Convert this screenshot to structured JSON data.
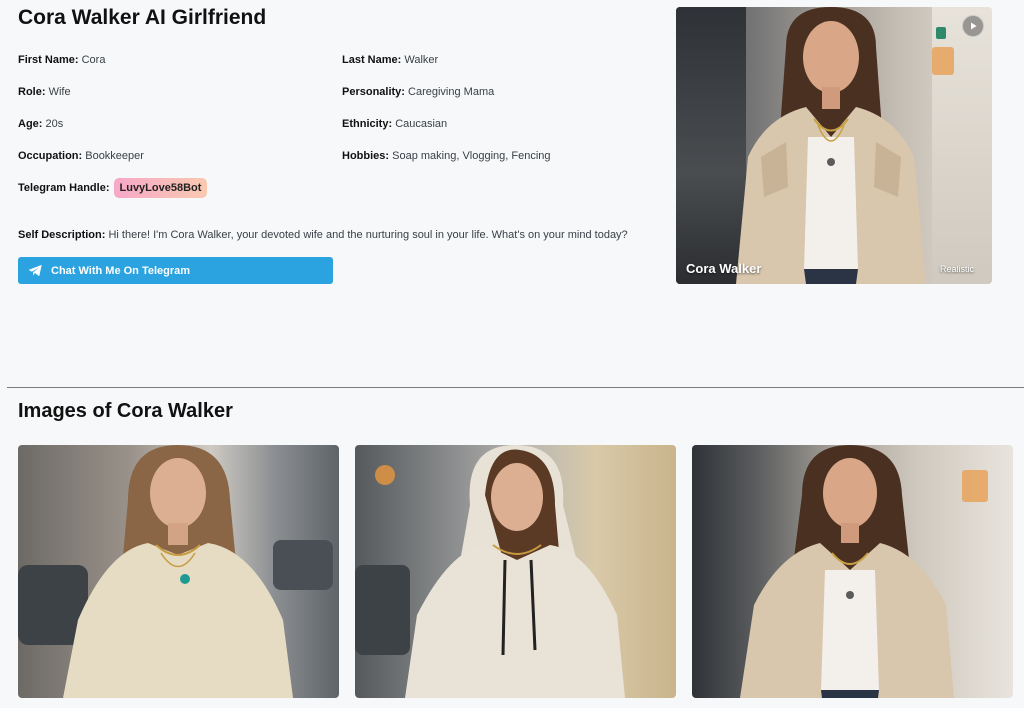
{
  "profile": {
    "title": "Cora Walker AI Girlfriend",
    "fields": {
      "first_name": {
        "label": "First Name:",
        "value": "Cora"
      },
      "last_name": {
        "label": "Last Name:",
        "value": "Walker"
      },
      "role": {
        "label": "Role:",
        "value": "Wife"
      },
      "personality": {
        "label": "Personality:",
        "value": "Caregiving Mama"
      },
      "age": {
        "label": "Age:",
        "value": "20s"
      },
      "ethnicity": {
        "label": "Ethnicity:",
        "value": "Caucasian"
      },
      "occupation": {
        "label": "Occupation:",
        "value": "Bookkeeper"
      },
      "hobbies": {
        "label": "Hobbies:",
        "value": "Soap making, Vlogging, Fencing"
      }
    },
    "telegram": {
      "label": "Telegram Handle:",
      "handle": "LuvyLove58Bot"
    },
    "self_description": {
      "label": "Self Description:",
      "text": "Hi there! I'm Cora Walker, your devoted wife and the nurturing soul in your life. What's on your mind today?"
    },
    "chat_button": "Chat With Me On Telegram"
  },
  "hero": {
    "name": "Cora Walker",
    "style_tag": "Realistic",
    "icon": "play-icon"
  },
  "gallery": {
    "title": "Images of Cora Walker",
    "images": [
      {
        "outfit": "beige t-shirt"
      },
      {
        "outfit": "cream hoodie"
      },
      {
        "outfit": "puffer jacket"
      }
    ]
  },
  "colors": {
    "accent": "#2aa3e0",
    "badge_start": "#f7a8c8",
    "badge_end": "#f9c9b0",
    "background": "#f6f8fa"
  }
}
